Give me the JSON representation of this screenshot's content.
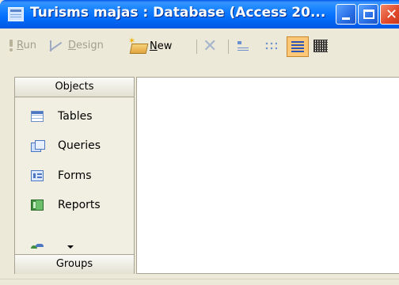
{
  "window": {
    "title": "Turisms majas : Database (Access 20..."
  },
  "toolbar": {
    "run_label": "un",
    "run_key": "R",
    "design_label": "esign",
    "design_key": "D",
    "new_label": "ew",
    "new_key": "N"
  },
  "objects_panel": {
    "header": "Objects",
    "groups_label": "Groups",
    "items": [
      {
        "label": "Tables",
        "icon": "table-icon"
      },
      {
        "label": "Queries",
        "icon": "query-icon"
      },
      {
        "label": "Forms",
        "icon": "form-icon"
      },
      {
        "label": "Reports",
        "icon": "report-icon"
      }
    ]
  },
  "colors": {
    "titlebar": "#0a64f0",
    "selected_view": "#fcc878",
    "panel_bg": "#f1efe2"
  }
}
